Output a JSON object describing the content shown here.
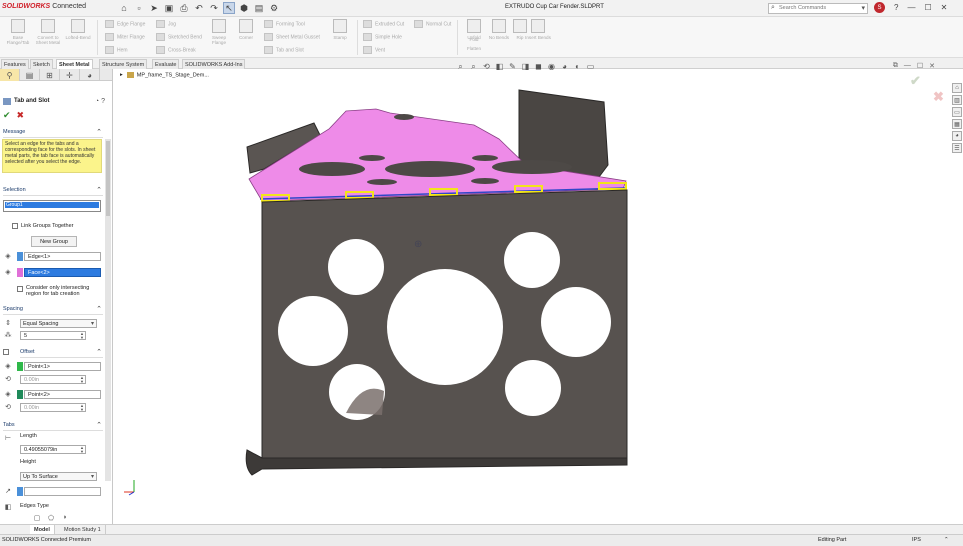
{
  "app": {
    "logo": "SOLIDWORKS",
    "logo_suffix": "Connected",
    "document_title": "EXTRUDO Cup Car Fender.SLDPRT"
  },
  "search": {
    "placeholder": "Search Commands"
  },
  "user": {
    "initial": "S"
  },
  "command_manager": {
    "big_buttons": [
      {
        "label": "Base Flange/Tab"
      },
      {
        "label": "Convert to Sheet Metal"
      },
      {
        "label": "Lofted-Bend"
      },
      {
        "label": "Sweep Flange"
      },
      {
        "label": "Corner"
      },
      {
        "label": "Stamp"
      },
      {
        "label": "Unfold"
      },
      {
        "label": "Fold"
      },
      {
        "label": "Flatten"
      },
      {
        "label": "No Bends"
      },
      {
        "label": "Rip"
      },
      {
        "label": "Insert Bends"
      }
    ],
    "small_buttons": [
      {
        "label": "Edge Flange"
      },
      {
        "label": "Miter Flange"
      },
      {
        "label": "Hem"
      },
      {
        "label": "Jog"
      },
      {
        "label": "Sketched Bend"
      },
      {
        "label": "Cross-Break"
      },
      {
        "label": "Forming Tool"
      },
      {
        "label": "Sheet Metal Gusset"
      },
      {
        "label": "Tab and Slot"
      },
      {
        "label": "Extruded Cut"
      },
      {
        "label": "Simple Hole"
      },
      {
        "label": "Vent"
      },
      {
        "label": "Normal Cut"
      }
    ]
  },
  "tabs": [
    "Features",
    "Sketch",
    "Sheet Metal",
    "Structure System",
    "Evaluate",
    "SOLIDWORKS Add-Ins"
  ],
  "active_tab": "Sheet Metal",
  "property_manager": {
    "title": "Tab and Slot",
    "message": {
      "header": "Message",
      "text": "Select an edge for the tabs and a corresponding face for the slots. In sheet metal parts, the tab face is automatically selected after you select the edge."
    },
    "selection": {
      "header": "Selection",
      "group": "Group1",
      "link_groups_label": "Link Groups Together",
      "new_group_button": "New Group",
      "edge": "Edge<1>",
      "face": "Face<2>",
      "consider_label": "Consider only intersecting region for tab creation"
    },
    "spacing": {
      "header": "Spacing",
      "type": "Equal Spacing",
      "count": "5"
    },
    "offset": {
      "header": "Offset",
      "point1": "Point<1>",
      "point1_distance": "0.00in",
      "point2": "Point<2>",
      "point2_distance": "0.00in"
    },
    "tabs": {
      "header": "Tabs",
      "length_label": "Length",
      "length_value": "0.49055079in",
      "height_label": "Height",
      "height_type": "Up To Surface",
      "edges_type_label": "Edges Type"
    }
  },
  "viewport": {
    "tree_root": "MP_frame_TS_Stage_Dem..."
  },
  "bottom_tabs": [
    "Model",
    "Motion Study 1"
  ],
  "status": {
    "product": "SOLIDWORKS Connected Premium",
    "mode": "Editing Part",
    "units": "IPS"
  },
  "colors": {
    "accent_red": "#d0202a",
    "selection_blue": "#2d7be0",
    "message_yellow": "#fbf48b",
    "part_gray": "#57524f",
    "face_pink": "#ee8be8",
    "tab_yellow": "#f2e51a"
  }
}
